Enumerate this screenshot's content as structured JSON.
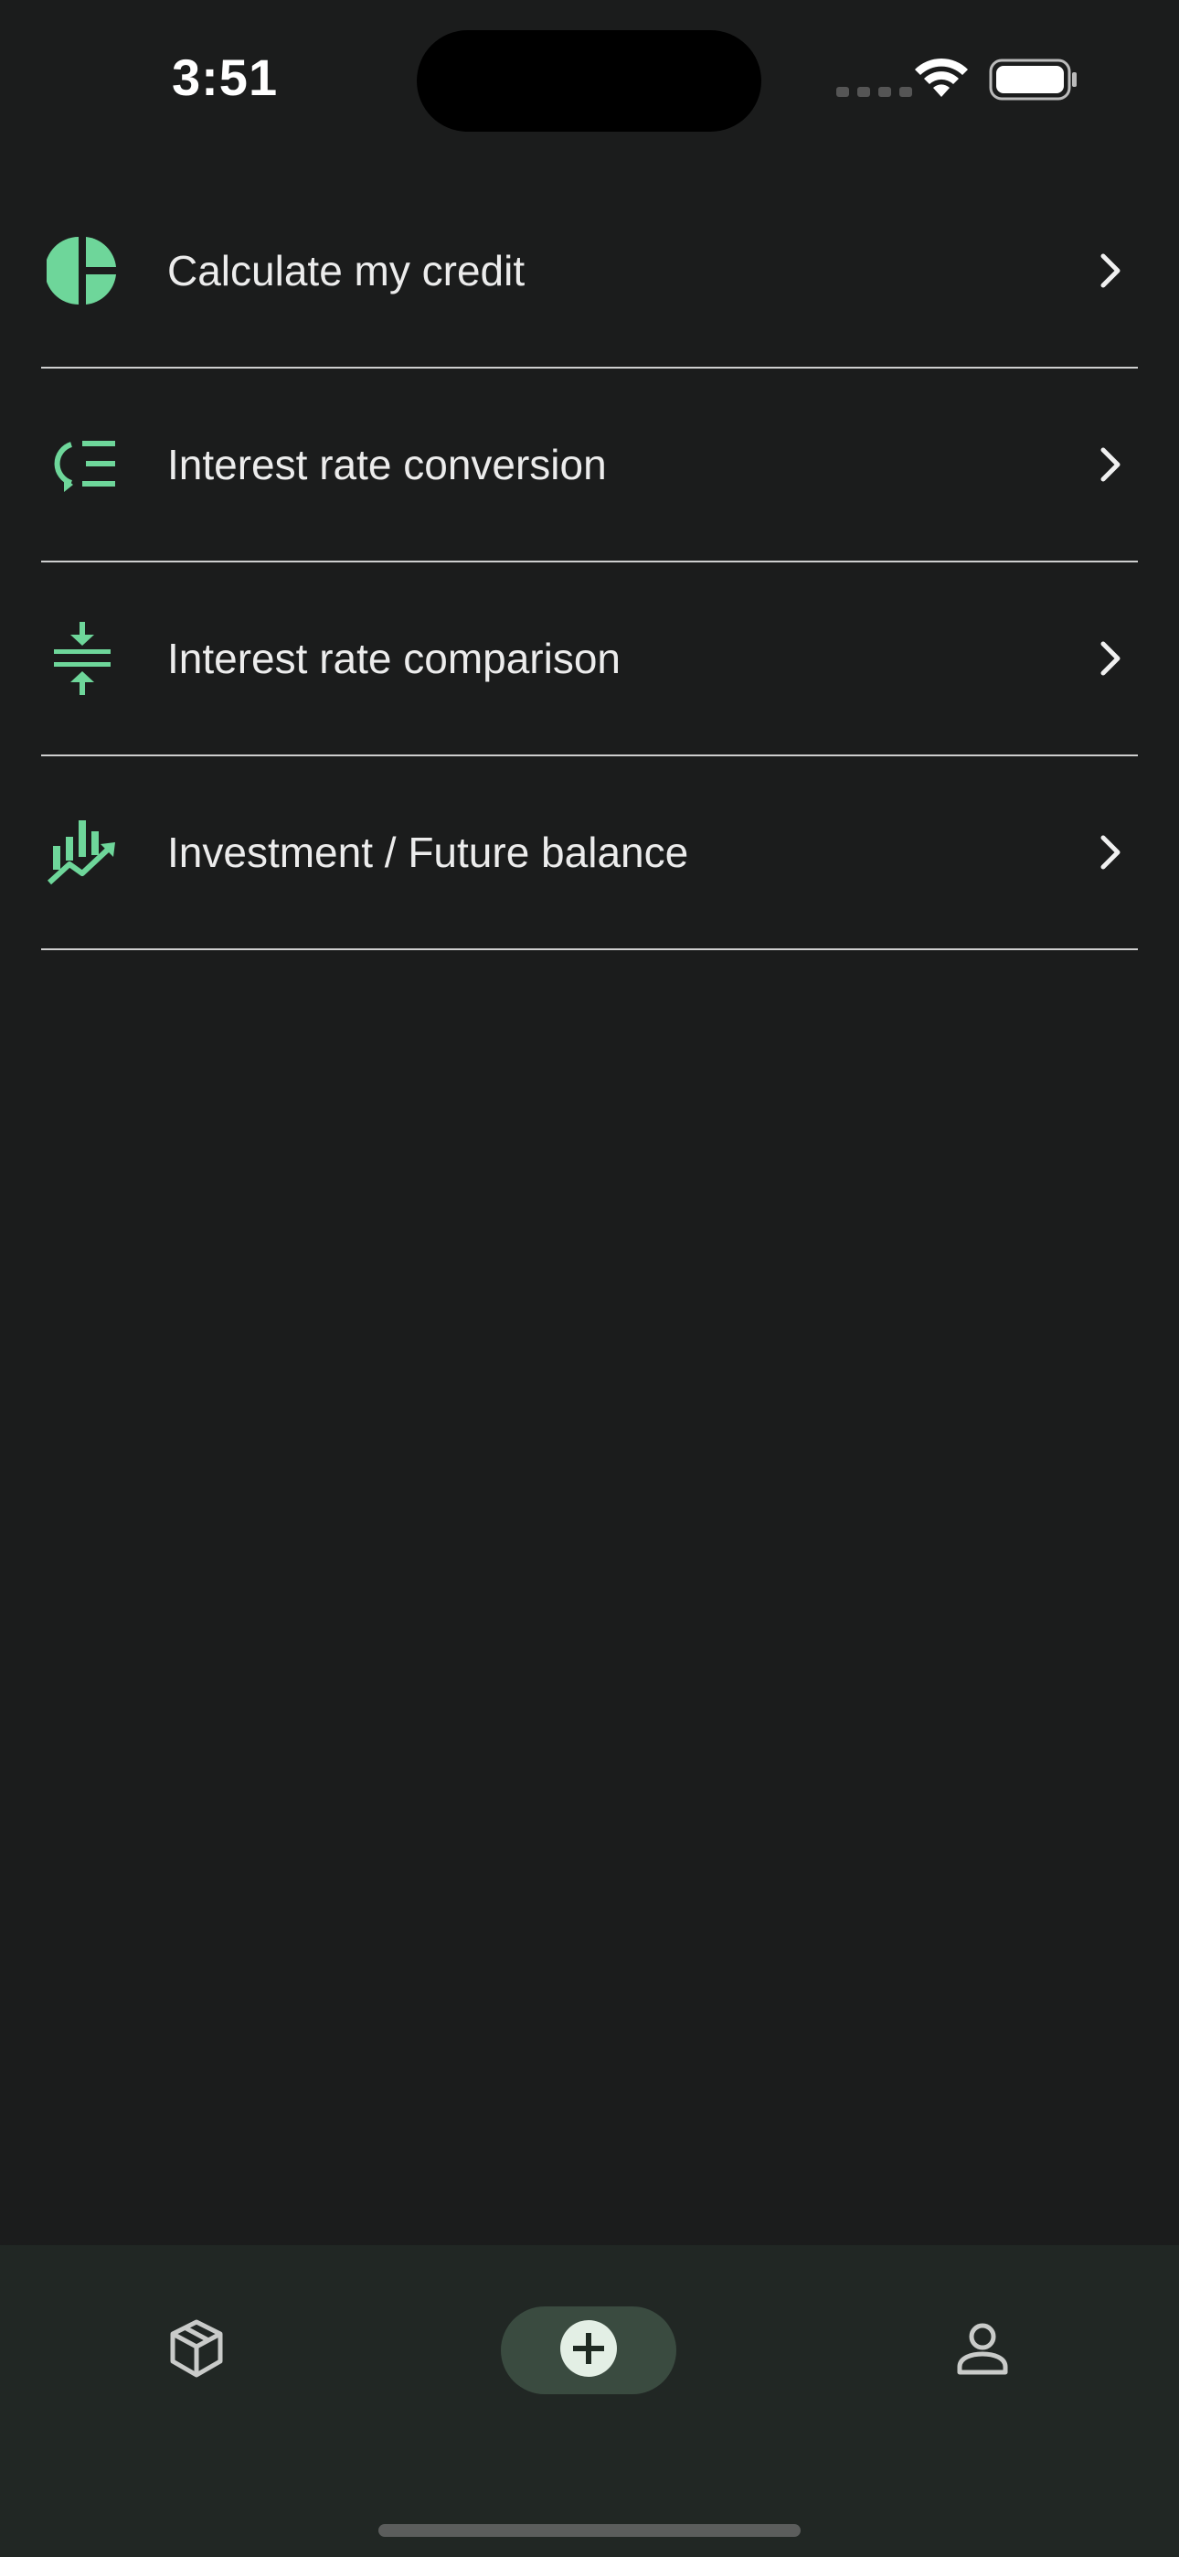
{
  "status_bar": {
    "time": "3:51"
  },
  "menu": {
    "items": [
      {
        "label": "Calculate my credit",
        "icon": "pie-chart-icon"
      },
      {
        "label": "Interest rate conversion",
        "icon": "convert-list-icon"
      },
      {
        "label": "Interest rate comparison",
        "icon": "compress-vertical-icon"
      },
      {
        "label": "Investment / Future balance",
        "icon": "bar-chart-trend-icon"
      }
    ]
  },
  "tab_bar": {
    "tabs": [
      {
        "icon": "cube-icon"
      },
      {
        "icon": "add-circle-icon",
        "selected": true
      },
      {
        "icon": "person-icon"
      }
    ]
  },
  "colors": {
    "accent": "#6ed69a",
    "background": "#1b1c1c",
    "tab_bar": "#212724",
    "tab_selected": "#3a4b40"
  }
}
